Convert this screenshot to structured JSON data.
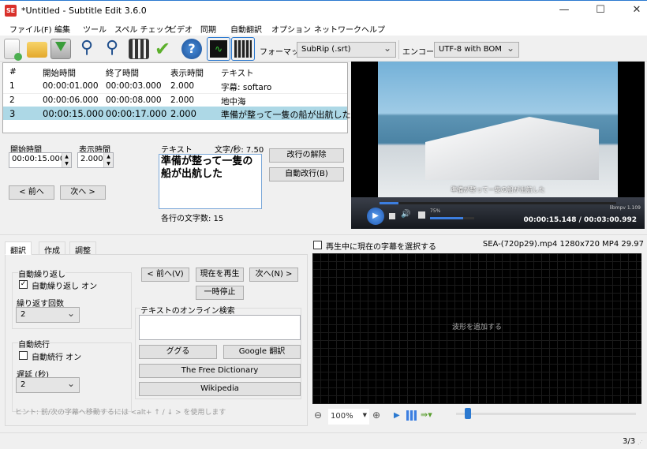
{
  "window": {
    "title": "*Untitled - Subtitle Edit 3.6.0",
    "logo": "SE",
    "minimize": "—",
    "maximize": "☐",
    "close": "✕"
  },
  "menu": [
    "ファイル(F)",
    "編集",
    "ツール",
    "スペル チェック",
    "ビデオ",
    "同期",
    "自動翻訳",
    "オプション",
    "ネットワーク",
    "ヘルプ"
  ],
  "toolbar": {
    "icons": [
      "new-file-icon",
      "open-folder-icon",
      "save-download-icon",
      "find-icon",
      "replace-icon",
      "visual-sync-icon",
      "spell-check-icon",
      "help-icon",
      "waveform-toggle-icon",
      "video-toggle-icon"
    ],
    "format_label": "フォーマット",
    "format_value": "SubRip (.srt)",
    "encoding_label": "エンコード",
    "encoding_value": "UTF-8 with BOM"
  },
  "subtitle_list": {
    "headers": [
      "#",
      "開始時間",
      "終了時間",
      "表示時間",
      "テキスト"
    ],
    "rows": [
      [
        "1",
        "00:00:01.000",
        "00:00:03.000",
        "2.000",
        "字幕: softaro"
      ],
      [
        "2",
        "00:00:06.000",
        "00:00:08.000",
        "2.000",
        "地中海"
      ],
      [
        "3",
        "00:00:15.000",
        "00:00:17.000",
        "2.000",
        "準備が整って一隻の船が出航した"
      ]
    ],
    "selected_index": 2
  },
  "editor": {
    "start_label": "開始時間",
    "start_value": "00:00:15.000",
    "duration_label": "表示時間",
    "duration_value": "2.000",
    "text_label": "テキスト",
    "cps": "文字/秒: 7.50",
    "text_line1": "準備が整って一隻の",
    "text_line2": "船が出航した",
    "line_length": "各行の文字数: 15",
    "prev": "< 前へ",
    "next": "次へ >",
    "unbreak": "改行の解除",
    "auto_break": "自動改行(B)"
  },
  "video": {
    "subtitle_overlay": "準備が整って一隻の船が出航した",
    "volume": "75%",
    "player": "libmpv 1.109",
    "time": "00:00:15.148 / 00:03:00.992",
    "progress": 0.08,
    "volume_level": 0.75
  },
  "tabs": [
    "翻訳",
    "作成",
    "調整"
  ],
  "translate": {
    "auto_repeat_group": "自動繰り返し",
    "auto_repeat_on": "自動繰り返し オン",
    "auto_repeat_checked": true,
    "repeat_count_label": "繰り返す回数",
    "repeat_count": "2",
    "auto_continue_group": "自動続行",
    "auto_continue_on": "自動続行 オン",
    "auto_continue_checked": false,
    "delay_label": "遅延 (秒)",
    "delay": "2",
    "prev": "< 前へ(V)",
    "play_current": "現在を再生",
    "next": "次へ(N) >",
    "pause": "一時停止",
    "search_group": "テキストのオンライン検索",
    "search_value": "",
    "google": "ググる",
    "google_translate": "Google 翻訳",
    "free_dictionary": "The Free Dictionary",
    "wikipedia": "Wikipedia",
    "hint": "ヒント: 前/次の字幕へ移動するには <alt+ ↑ / ↓ > を使用します"
  },
  "waveform": {
    "select_current_label": "再生中に現在の字幕を選択する",
    "select_current_checked": false,
    "video_info": "SEA-(720p29).mp4 1280x720 MP4 29.97",
    "placeholder": "波形を追加する",
    "zoom": "100%",
    "slider_position": 0.05
  },
  "status": {
    "position": "3/3"
  }
}
